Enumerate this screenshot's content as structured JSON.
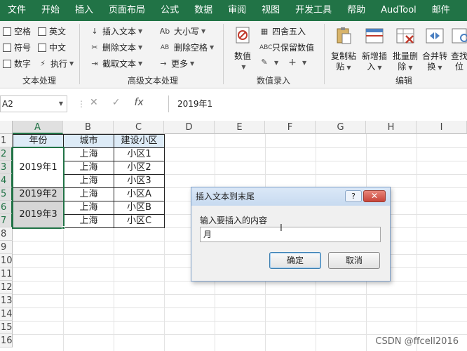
{
  "ribbon_tabs": [
    "文件",
    "开始",
    "插入",
    "页面布局",
    "公式",
    "数据",
    "审阅",
    "视图",
    "开发工具",
    "帮助",
    "AudTool",
    "邮件"
  ],
  "ribbon": {
    "text_group": {
      "label": "文本处理",
      "checkboxes": [
        "空格",
        "英文",
        "符号",
        "中文",
        "数字"
      ],
      "execute_label": "执行"
    },
    "advanced_group": {
      "label": "高级文本处理",
      "insert_text": "插入文本",
      "delete_text": "删除文本",
      "extract_text": "截取文本",
      "case": "大小写",
      "delete_space": "删除空格",
      "more": "更多"
    },
    "number_group": {
      "label": "数值录入",
      "number": "数值",
      "round": "四舍五入",
      "keep_value": "只保留数值"
    },
    "edit_group": {
      "label": "编辑",
      "copy_paste": [
        "复制粘",
        "贴"
      ],
      "new_insert": [
        "新增插",
        "入"
      ],
      "batch_delete": [
        "批量删",
        "除"
      ],
      "merge_convert": [
        "合并转",
        "换"
      ],
      "find_locate": [
        "查找",
        "位"
      ]
    }
  },
  "formula_bar": {
    "name_box": "A2",
    "cancel_icon": "✕",
    "confirm_icon": "✓",
    "fx_icon": "fx",
    "formula": "2019年1"
  },
  "sheet": {
    "columns": [
      "A",
      "B",
      "C",
      "D",
      "E",
      "F",
      "G",
      "H",
      "I"
    ],
    "rows": [
      "1",
      "2",
      "3",
      "4",
      "5",
      "6",
      "7",
      "8",
      "9",
      "10",
      "11",
      "12",
      "13",
      "14",
      "15",
      "16"
    ],
    "headers": [
      "年份",
      "城市",
      "建设小区"
    ],
    "year_cells": [
      "2019年1",
      "2019年2",
      "2019年3"
    ],
    "cities": [
      "上海",
      "上海",
      "上海",
      "上海",
      "上海",
      "上海"
    ],
    "districts": [
      "小区1",
      "小区2",
      "小区3",
      "小区A",
      "小区B",
      "小区C"
    ]
  },
  "dialog": {
    "title": "插入文本到末尾",
    "help_label": "?",
    "close_label": "✕",
    "prompt": "输入要插入的内容",
    "input_value": "月",
    "ok_label": "确定",
    "cancel_label": "取消"
  },
  "watermark": "CSDN @ffcell2016",
  "colors": {
    "ribbon_green": "#217346",
    "header_fill": "#ddebf7",
    "merged_gray": "#d6d6d6"
  }
}
